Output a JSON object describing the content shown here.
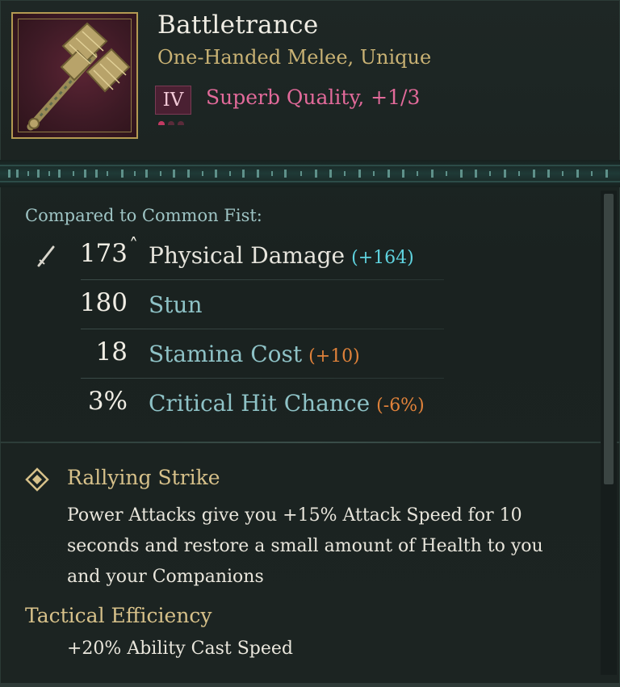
{
  "item": {
    "name": "Battletrance",
    "type_line": "One-Handed Melee, Unique",
    "tier": "IV",
    "quality_text": "Superb Quality, +1/3",
    "quality_pips": {
      "filled": 1,
      "total": 3
    },
    "icon": "spiked-mace-icon"
  },
  "comparison": {
    "label": "Compared to Common Fist:",
    "stats": [
      {
        "value": "173",
        "marker": "˄",
        "label": "Physical Damage",
        "delta": "(+164)",
        "delta_type": "positive",
        "icon": "sword-icon"
      },
      {
        "value": "180",
        "marker": "",
        "label": "Stun",
        "delta": "",
        "delta_type": ""
      },
      {
        "value": "18",
        "marker": "",
        "label": "Stamina Cost",
        "delta": "(+10)",
        "delta_type": "negative"
      },
      {
        "value": "3%",
        "marker": "",
        "label": "Critical Hit Chance",
        "delta": "(-6%)",
        "delta_type": "negative"
      }
    ]
  },
  "ability": {
    "name": "Rallying Strike",
    "icon": "diamond-icon",
    "description": "Power Attacks give you +15% Attack Speed for 10 seconds and restore a small amount of Health to you and your Companions"
  },
  "passive": {
    "name": "Tactical Efficiency",
    "description": "+20% Ability Cast Speed"
  },
  "colors": {
    "gold": "#d7c18a",
    "quality_pink": "#e26a9a",
    "stat_teal": "#8ec2c6",
    "delta_positive": "#5fd4e0",
    "delta_negative": "#e0823a"
  }
}
